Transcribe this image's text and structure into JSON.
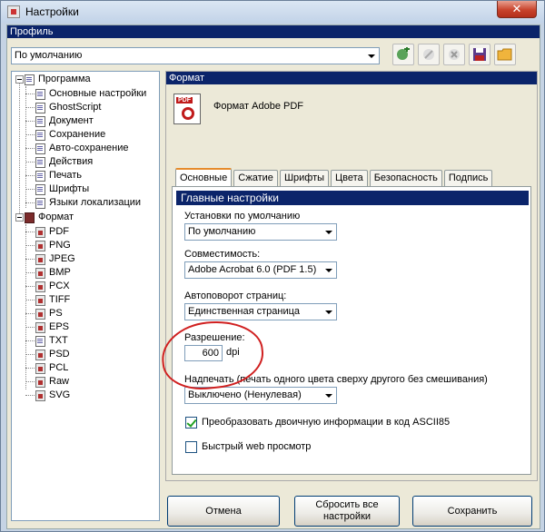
{
  "window": {
    "title": "Настройки",
    "close_label": "✕"
  },
  "profile": {
    "header": "Профиль",
    "selected": "По умолчанию",
    "toolbar_icons": [
      "add-profile-icon",
      "rename-profile-icon",
      "delete-profile-icon",
      "save-profile-icon",
      "open-folder-icon"
    ]
  },
  "tree": {
    "program": {
      "label": "Программа",
      "children": [
        "Основные настройки",
        "GhostScript",
        "Документ",
        "Сохранение",
        "Авто-сохранение",
        "Действия",
        "Печать",
        "Шрифты",
        "Языки локализации"
      ]
    },
    "format": {
      "label": "Формат",
      "children": [
        "PDF",
        "PNG",
        "JPEG",
        "BMP",
        "PCX",
        "TIFF",
        "PS",
        "EPS",
        "TXT",
        "PSD",
        "PCL",
        "Raw",
        "SVG"
      ]
    }
  },
  "panel": {
    "header": "Формат",
    "format_name": "Формат Adobe PDF",
    "icon_label": "PDF",
    "tabs": [
      "Основные",
      "Сжатие",
      "Шрифты",
      "Цвета",
      "Безопасность",
      "Подпись"
    ],
    "active_tab": "Основные",
    "group_title": "Главные настройки",
    "defaults_label": "Установки по умолчанию",
    "defaults_value": "По умолчанию",
    "compat_label": "Совместимость:",
    "compat_value": "Adobe Acrobat 6.0 (PDF 1.5)",
    "autorotate_label": "Автоповорот страниц:",
    "autorotate_value": "Единственная страница",
    "resolution_label": "Разрешение:",
    "resolution_value": "600",
    "resolution_unit": "dpi",
    "overprint_label": "Надпечать (печать одного цвета сверху другого без смешивания)",
    "overprint_value": "Выключено (Ненулевая)",
    "ascii85_label": "Преобразовать двоичную информации в код ASCII85",
    "ascii85_checked": true,
    "fastweb_label": "Быстрый web просмотр",
    "fastweb_checked": false
  },
  "buttons": {
    "cancel": "Отмена",
    "reset": "Сбросить все настройки",
    "save": "Сохранить"
  },
  "colors": {
    "header_bg": "#0b246a",
    "annotation": "#d02020"
  }
}
